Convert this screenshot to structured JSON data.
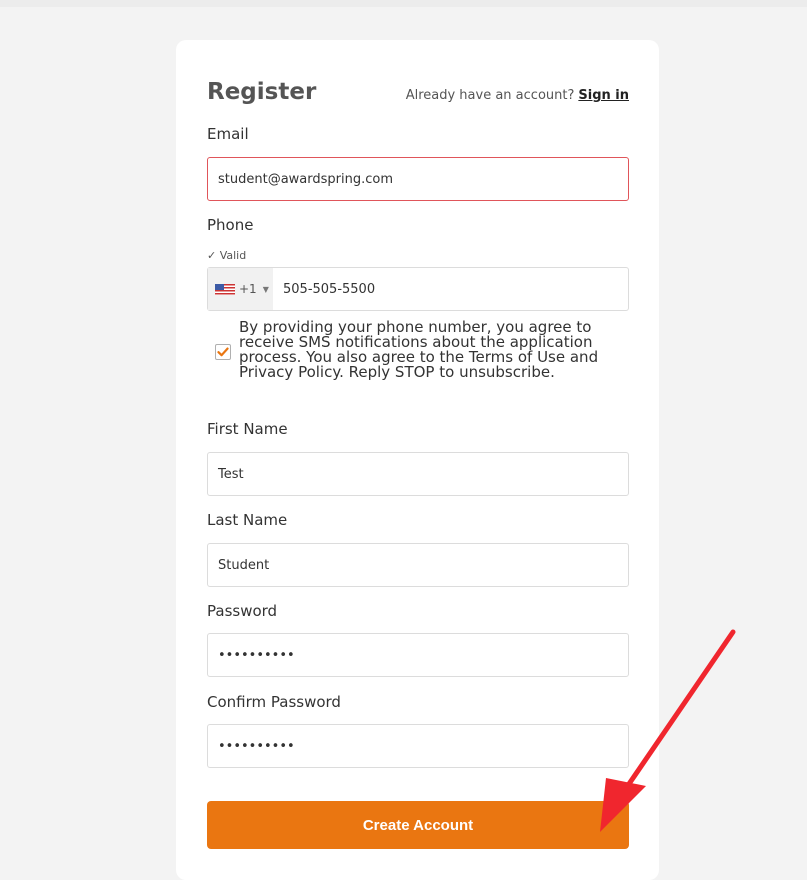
{
  "form": {
    "title": "Register",
    "signin_prompt": "Already have an account?",
    "signin_link": "Sign in",
    "email_label": "Email",
    "email_value": "student@awardspring.com",
    "phone_label": "Phone",
    "phone_valid_text": "✓ Valid",
    "phone_country_code": "+1",
    "phone_value": "505-505-5500",
    "consent_checked": true,
    "consent_text": "By providing your phone number, you agree to receive SMS notifications about the application process. You also agree to the Terms of Use and Privacy Policy. Reply STOP to unsubscribe.",
    "first_name_label": "First Name",
    "first_name_value": "Test",
    "last_name_label": "Last Name",
    "last_name_value": "Student",
    "password_label": "Password",
    "password_value": "••••••••••",
    "confirm_password_label": "Confirm Password",
    "confirm_password_value": "••••••••••",
    "submit_label": "Create Account"
  },
  "colors": {
    "accent": "#ea7611",
    "error_border": "#e0555a",
    "annotation_arrow": "#f0262e"
  },
  "icons": {
    "flag": "us-flag-icon",
    "caret": "caret-down-icon",
    "checkbox": "checkmark-icon",
    "annotation": "red-arrow-annotation"
  }
}
